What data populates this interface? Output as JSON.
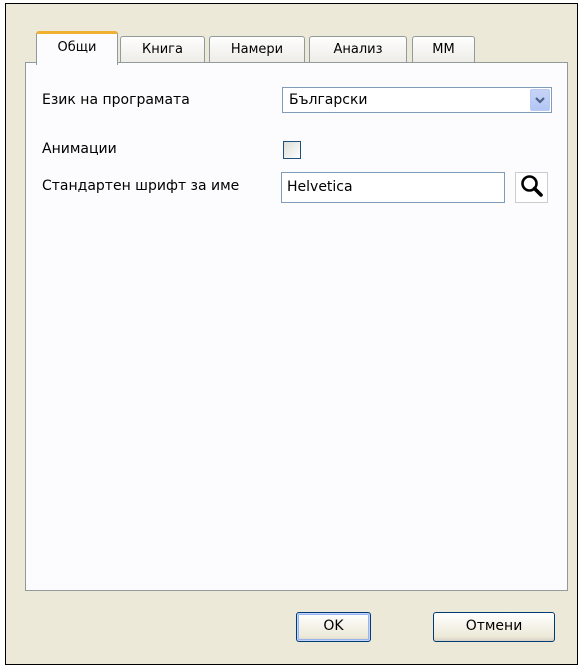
{
  "tabs": [
    "Общи",
    "Книга",
    "Намери",
    "Анализ",
    "ММ"
  ],
  "active_tab": 0,
  "settings": {
    "language_label": "Език на програмата",
    "language_value": "Български",
    "animations_label": "Анимации",
    "animations_checked": false,
    "font_label": "Стандартен шрифт за име",
    "font_value": "Helvetica"
  },
  "buttons": {
    "ok": "OK",
    "cancel": "Отмени"
  },
  "icons": {
    "dropdown": "chevron-down-icon",
    "search": "magnifier-icon"
  }
}
